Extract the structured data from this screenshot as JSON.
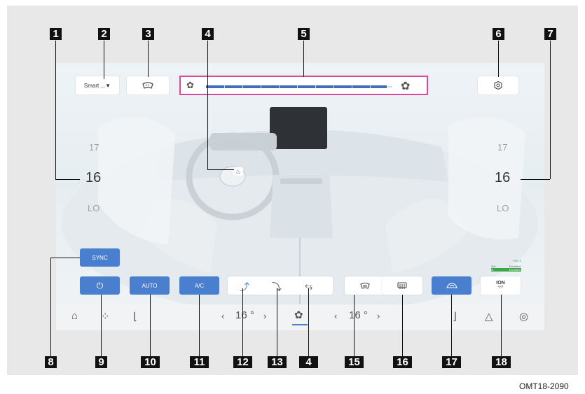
{
  "figure_code": "OMT18-2090",
  "callouts": [
    "1",
    "2",
    "3",
    "4",
    "5",
    "6",
    "7",
    "8",
    "9",
    "10",
    "11",
    "12",
    "13",
    "4",
    "15",
    "16",
    "17",
    "18"
  ],
  "top": {
    "mode_label": "Smart ...▼",
    "front_defrost_icon": "windshield-defrost-icon",
    "settings_icon": "gear-icon"
  },
  "fan": {
    "level": 0.92,
    "left_icon": "fan-low-icon",
    "right_icon": "fan-high-icon"
  },
  "left_temp": {
    "upper": "17",
    "current": "16",
    "lower": "LO"
  },
  "right_temp": {
    "upper": "17",
    "current": "16",
    "lower": "LO"
  },
  "buttons": {
    "sync": "SYNC",
    "power": "⏻",
    "auto": "AUTO",
    "ac": "A/C",
    "ion": "ION"
  },
  "air_quality": {
    "label": "PM2.5",
    "out_label": "Out",
    "out_value": "Excellent",
    "in_label": "In",
    "in_value": "Excellent"
  },
  "nav": {
    "left_temp": "16 °",
    "right_temp": "16 °",
    "left_arrow": "‹",
    "right_arrow": "›"
  },
  "colors": {
    "accent_blue": "#4a7fd0",
    "highlight_pink": "#d94a9a",
    "good_green": "#3aa84a"
  }
}
